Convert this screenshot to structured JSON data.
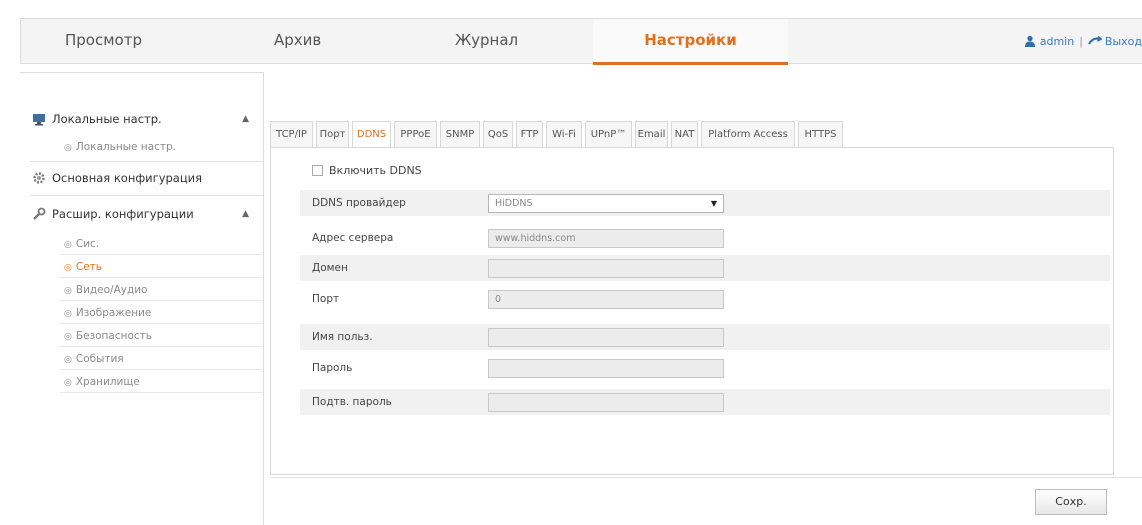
{
  "nav": {
    "items": [
      {
        "label": "Просмотр"
      },
      {
        "label": "Архив"
      },
      {
        "label": "Журнал"
      },
      {
        "label": "Настройки"
      }
    ],
    "user": "admin",
    "separator": "|",
    "logout": "Выход"
  },
  "sidebar": {
    "groups": [
      {
        "label": "Локальные настр.",
        "children": [
          "Локальные настр."
        ]
      },
      {
        "label": "Основная конфигурация",
        "children": []
      },
      {
        "label": "Расшир. конфигурации",
        "children": [
          "Сис.",
          "Сеть",
          "Видео/Аудио",
          "Изображение",
          "Безопасность",
          "События",
          "Хранилище"
        ]
      }
    ],
    "active_child": "Сеть"
  },
  "tabs": [
    {
      "label": "TCP/IP"
    },
    {
      "label": "Порт"
    },
    {
      "label": "DDNS"
    },
    {
      "label": "PPPoE"
    },
    {
      "label": "SNMP"
    },
    {
      "label": "QoS"
    },
    {
      "label": "FTP"
    },
    {
      "label": "Wi-Fi"
    },
    {
      "label": "UPnP™"
    },
    {
      "label": "Email"
    },
    {
      "label": "NAT"
    },
    {
      "label": "Platform Access"
    },
    {
      "label": "HTTPS"
    }
  ],
  "form": {
    "enable_label": "Включить DDNS",
    "enable_checked": false,
    "provider": {
      "label": "DDNS провайдер",
      "value": "HiDDNS"
    },
    "server": {
      "label": "Адрес сервера",
      "value": "www.hiddns.com"
    },
    "domain": {
      "label": "Домен",
      "value": ""
    },
    "port": {
      "label": "Порт",
      "value": "0"
    },
    "username": {
      "label": "Имя польз.",
      "value": ""
    },
    "password": {
      "label": "Пароль",
      "value": ""
    },
    "confirm": {
      "label": "Подтв. пароль",
      "value": ""
    }
  },
  "save_label": "Сохр.",
  "colors": {
    "accent": "#e0701e",
    "link": "#3a7bbf",
    "row_shade": "#f1f1f1"
  }
}
